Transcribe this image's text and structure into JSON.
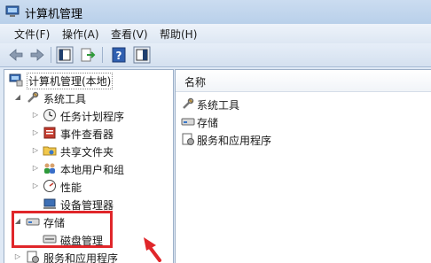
{
  "window": {
    "title": "计算机管理"
  },
  "menu": [
    {
      "label": "文件(F)"
    },
    {
      "label": "操作(A)"
    },
    {
      "label": "查看(V)"
    },
    {
      "label": "帮助(H)"
    }
  ],
  "tree": {
    "root": "计算机管理(本地)",
    "system_tools": "系统工具",
    "task_scheduler": "任务计划程序",
    "event_viewer": "事件查看器",
    "shared_folders": "共享文件夹",
    "local_users": "本地用户和组",
    "performance": "性能",
    "device_manager": "设备管理器",
    "storage": "存储",
    "disk_management": "磁盘管理",
    "services_apps": "服务和应用程序"
  },
  "list": {
    "header": "名称",
    "items": [
      "系统工具",
      "存储",
      "服务和应用程序"
    ]
  },
  "colors": {
    "highlight": "#e0262a",
    "arrow": "#e0262a"
  }
}
